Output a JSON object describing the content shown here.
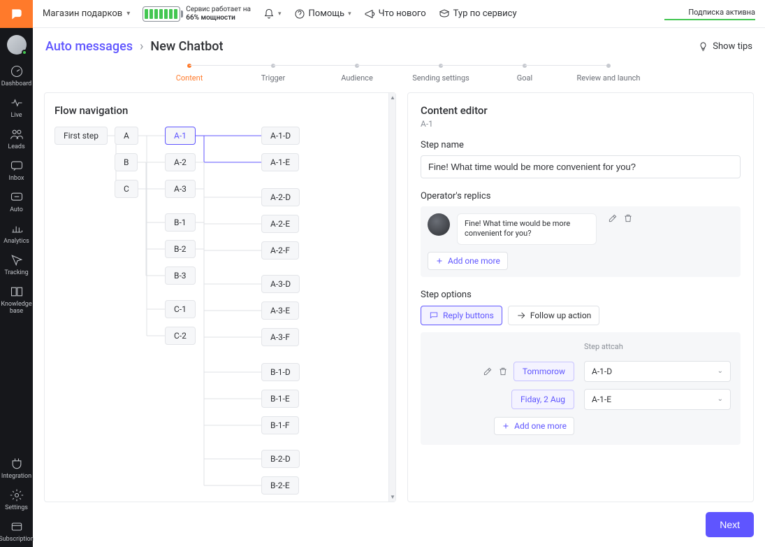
{
  "topbar": {
    "store_selector": "Магазин подарков",
    "battery_line1": "Сервис работает на",
    "battery_line2": "66% мощности",
    "help": "Помощь",
    "whatsnew": "Что нового",
    "tour": "Тур по сервису",
    "subscription": "Подписка активна"
  },
  "nav": {
    "dashboard": "Dashboard",
    "live": "Live",
    "leads": "Leads",
    "inbox": "Inbox",
    "auto": "Auto",
    "analytics": "Analytics",
    "tracking": "Tracking",
    "knowledge": "Knowledge base",
    "integration": "Integration",
    "settings": "Settings",
    "subscription": "Subscription"
  },
  "breadcrumb": {
    "auto_messages": "Auto messages",
    "new_chatbot": "New Chatbot",
    "show_tips": "Show tips"
  },
  "stepper": [
    "Content",
    "Trigger",
    "Audience",
    "Sending settings",
    "Goal",
    "Review and  launch"
  ],
  "flow": {
    "title": "Flow navigation",
    "first_step": "First step",
    "col1": [
      "A",
      "B",
      "C"
    ],
    "col2": [
      "A-1",
      "A-2",
      "A-3",
      "B-1",
      "B-2",
      "B-3",
      "C-1",
      "C-2"
    ],
    "col3": [
      "A-1-D",
      "A-1-E",
      "A-2-D",
      "A-2-E",
      "A-2-F",
      "A-3-D",
      "A-3-E",
      "A-3-F",
      "B-1-D",
      "B-1-E",
      "B-1-F",
      "B-2-D",
      "B-2-E"
    ],
    "selected": "A-1"
  },
  "editor": {
    "title": "Content editor",
    "sub": "A-1",
    "stepname_label": "Step name",
    "stepname_value": "Fine! What time would be more convenient for you?",
    "replics_label": "Operator's replics",
    "replic_text": "Fine! What time would be more convenient for you?",
    "add_more": "Add one more",
    "options_label": "Step options",
    "tab_reply": "Reply buttons",
    "tab_follow": "Follow up action",
    "step_attach_label": "Step attcah",
    "reply1": "Tommorow",
    "reply2": "Fiday, 2 Aug",
    "attach1": "A-1-D",
    "attach2": "A-1-E",
    "add_reply": "Add one more"
  },
  "footer": {
    "next": "Next"
  }
}
